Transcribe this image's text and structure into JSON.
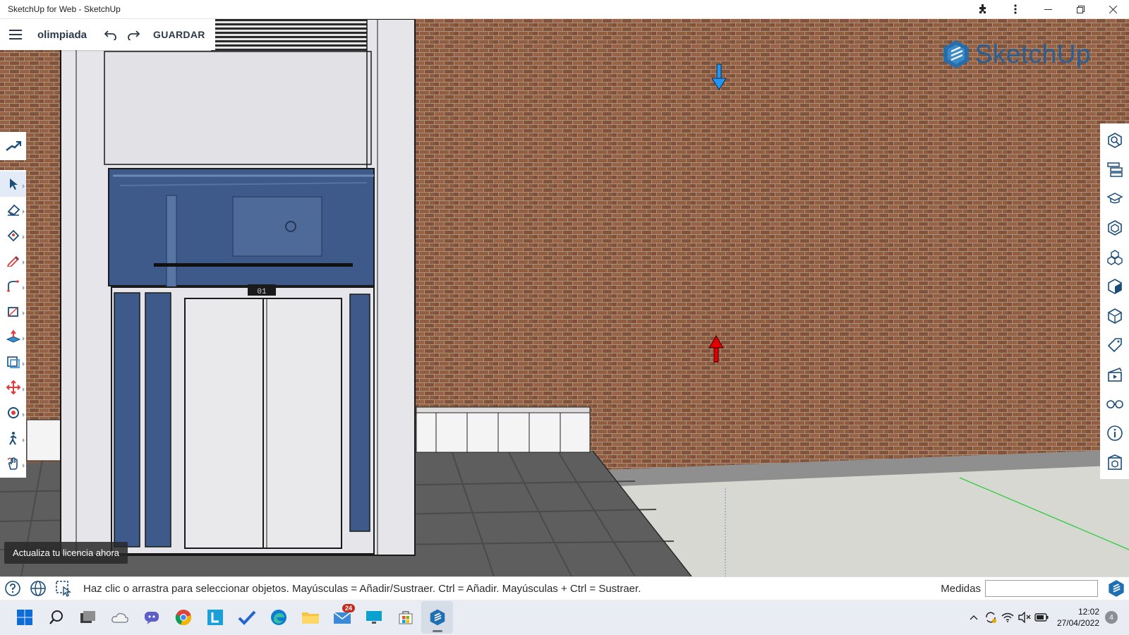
{
  "window": {
    "title": "SketchUp for Web - SketchUp",
    "controls": [
      "extensions-icon",
      "more-vertical-icon",
      "minimize-icon",
      "restore-icon",
      "close-icon"
    ]
  },
  "header": {
    "file_name": "olimpiada",
    "save_label": "GUARDAR"
  },
  "logo": {
    "text": "SketchUp"
  },
  "left_toolbar": {
    "top_tool": "search-tool-icon",
    "tools": [
      "select",
      "eraser",
      "paint-bucket",
      "pencil",
      "arc",
      "rectangle",
      "push-pull",
      "offset",
      "move",
      "orbit",
      "walk",
      "pan"
    ],
    "active_tool": "select"
  },
  "right_toolbar": {
    "panels": [
      "entity-info",
      "outliner",
      "instructor",
      "materials",
      "components",
      "styles",
      "scenes-layers",
      "tags",
      "scenes",
      "display",
      "model-info",
      "3d-warehouse"
    ]
  },
  "license_notice": "Actualiza tu licencia ahora",
  "status": {
    "message": "Haz clic o arrastra para seleccionar objetos. Mayúsculas = Añadir/Sustraer. Ctrl = Añadir. Mayúsculas + Ctrl = Sustraer.",
    "measurements_label": "Medidas",
    "measurements_value": ""
  },
  "scene": {
    "elevator_floor_display": "01",
    "colors": {
      "brick": "#8d5a3c",
      "glass": "#3d5a8a",
      "frame": "#e4e4e8",
      "floor_tile": "#5e5e5e",
      "ground": "#d8d8d2",
      "axis_green": "#2ecc40",
      "axis_blue_arrow": "#2196f3",
      "axis_red_arrow": "#e00000"
    }
  },
  "taskbar": {
    "apps": [
      "start",
      "search",
      "task-view",
      "onedrive",
      "teams",
      "chrome",
      "l-app",
      "todo",
      "edge",
      "file-explorer",
      "mail",
      "remote-desktop",
      "store",
      "sketchup"
    ],
    "mail_badge": "24",
    "time": "12:02",
    "date": "27/04/2022",
    "notifications": "4"
  }
}
